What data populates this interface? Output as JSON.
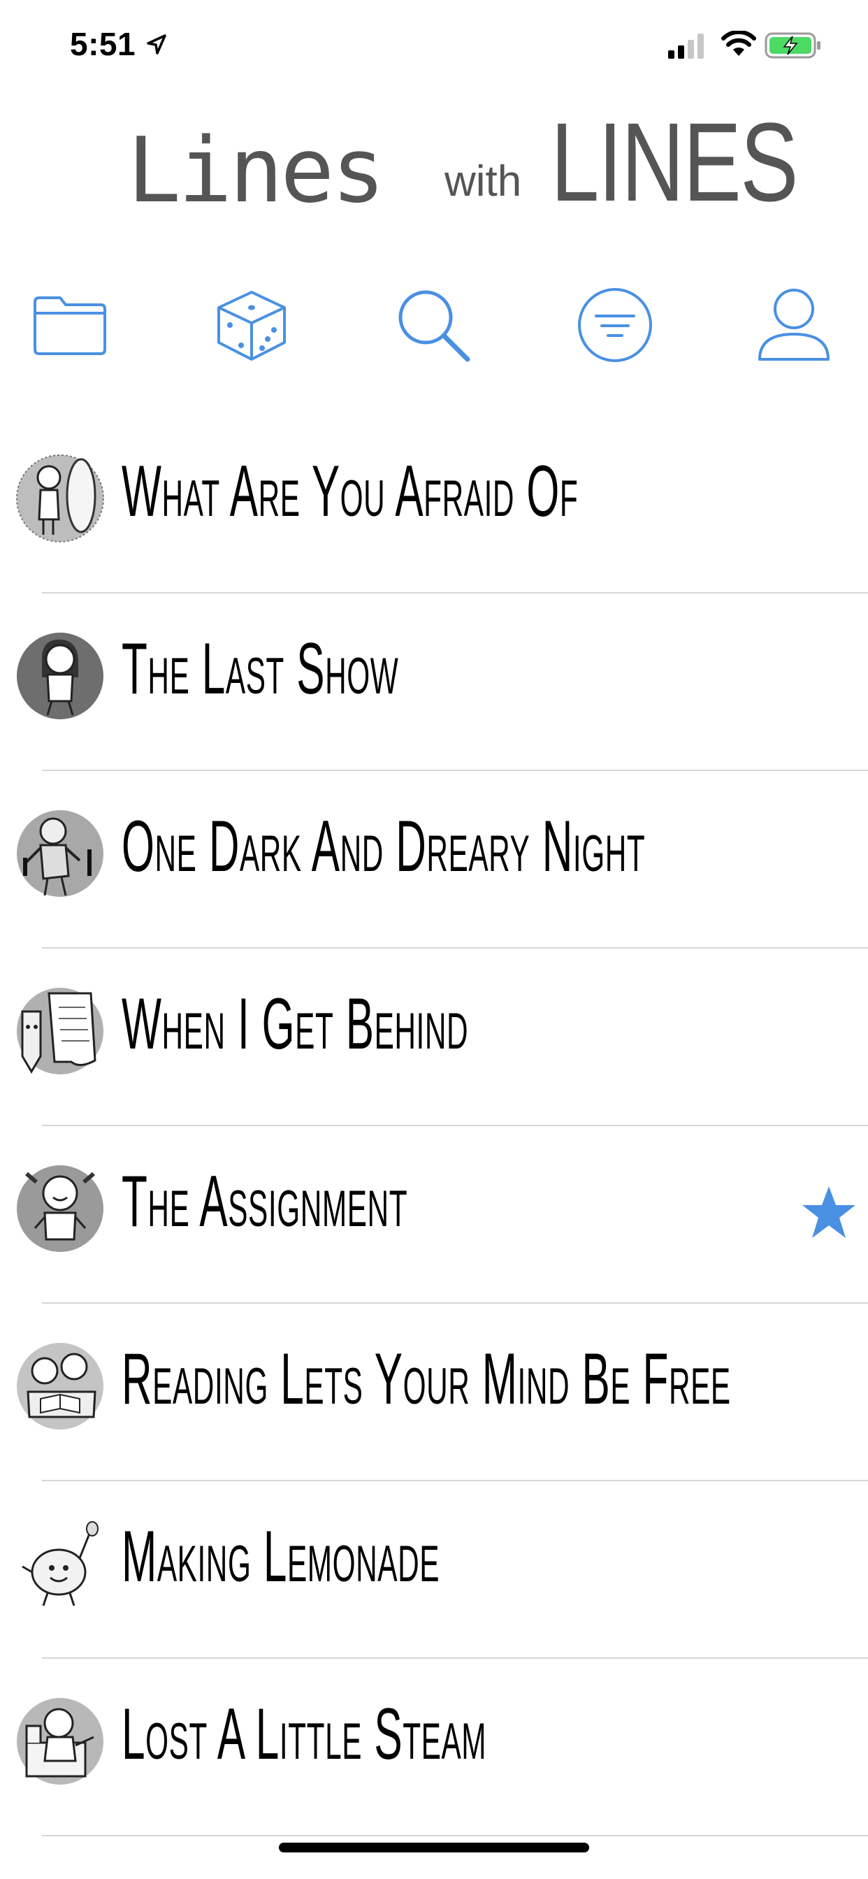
{
  "status_bar": {
    "time": "5:51",
    "icons": [
      "location-arrow-icon",
      "cellular-signal-icon",
      "wifi-icon",
      "battery-charging-icon"
    ]
  },
  "logo": {
    "word1": "Lines",
    "word2": "with",
    "word3": "LINES"
  },
  "toolbar": {
    "accent": "#4a90e2",
    "items": [
      {
        "icon": "folder-icon"
      },
      {
        "icon": "dice-icon"
      },
      {
        "icon": "search-icon"
      },
      {
        "icon": "filter-icon"
      },
      {
        "icon": "profile-icon"
      }
    ]
  },
  "poems": [
    {
      "title": "What Are You Afraid Of",
      "favorite": false,
      "thumb": "girl-mirror"
    },
    {
      "title": "The Last Show",
      "favorite": false,
      "thumb": "girl-thinking"
    },
    {
      "title": "One Dark And Dreary Night",
      "favorite": false,
      "thumb": "zombie"
    },
    {
      "title": "When I Get Behind",
      "favorite": false,
      "thumb": "pencil-paper"
    },
    {
      "title": "The Assignment",
      "favorite": true,
      "thumb": "girl-pigtails"
    },
    {
      "title": "Reading Lets Your Mind Be Free",
      "favorite": false,
      "thumb": "kids-reading"
    },
    {
      "title": "Making Lemonade",
      "favorite": false,
      "thumb": "lemon"
    },
    {
      "title": "Lost A Little Steam",
      "favorite": false,
      "thumb": "boy-chair"
    }
  ]
}
